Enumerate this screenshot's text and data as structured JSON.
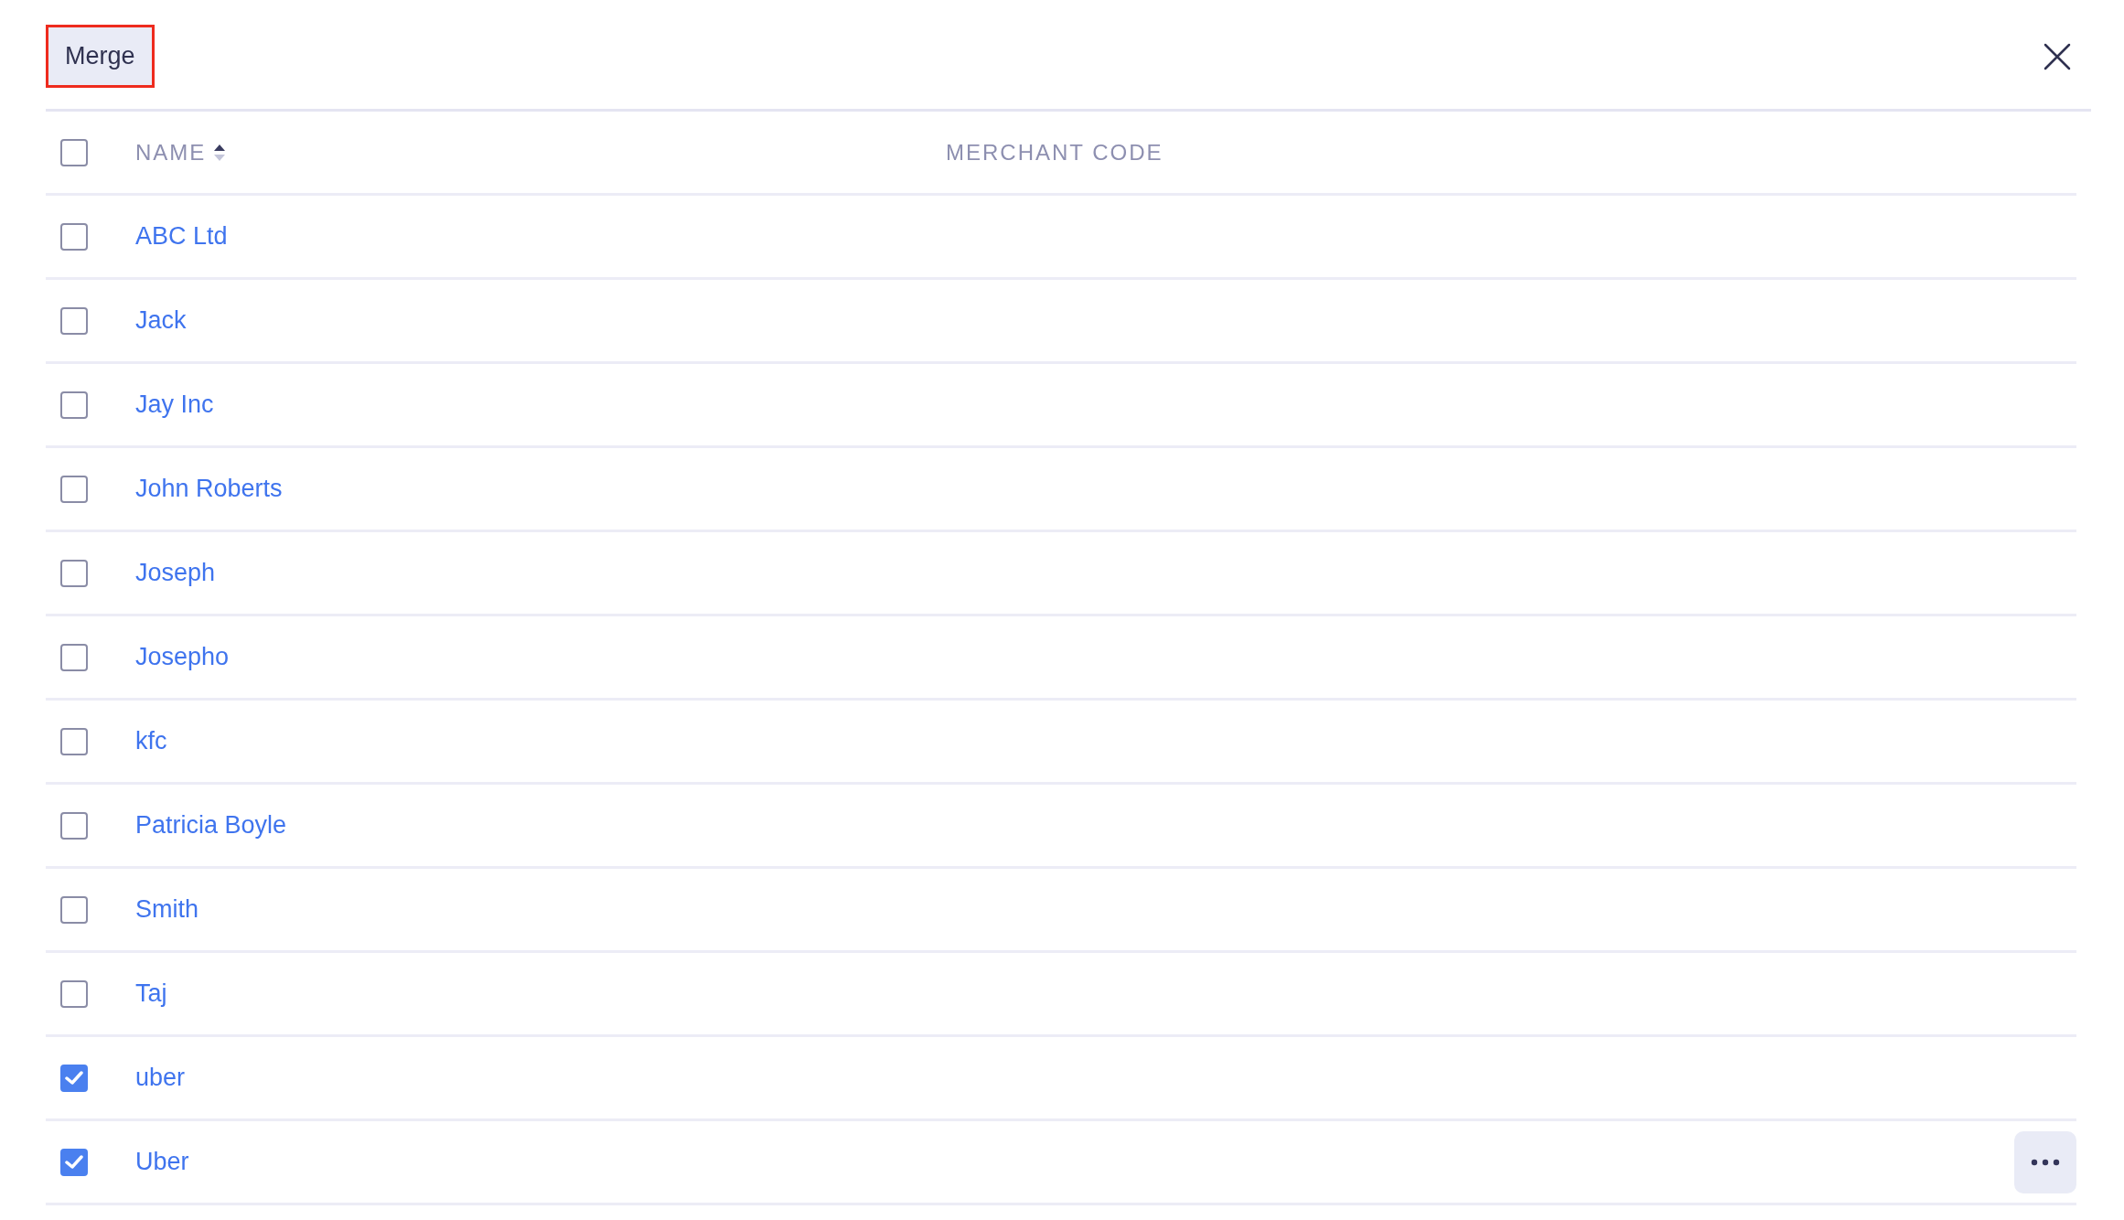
{
  "toolbar": {
    "merge_button": {
      "label": "Merge",
      "highlighted": true
    }
  },
  "table": {
    "select_all": {
      "checked": false
    },
    "columns": [
      {
        "label": "NAME",
        "sorted_ascending": true
      },
      {
        "label": "MERCHANT CODE"
      }
    ],
    "rows": [
      {
        "name": "ABC Ltd",
        "checked": false,
        "menu_button": false
      },
      {
        "name": "Jack",
        "checked": false,
        "menu_button": false
      },
      {
        "name": "Jay Inc",
        "checked": false,
        "menu_button": false
      },
      {
        "name": "John Roberts",
        "checked": false,
        "menu_button": false
      },
      {
        "name": "Joseph",
        "checked": false,
        "menu_button": false
      },
      {
        "name": "Josepho",
        "checked": false,
        "menu_button": false
      },
      {
        "name": "kfc",
        "checked": false,
        "menu_button": false
      },
      {
        "name": "Patricia Boyle",
        "checked": false,
        "menu_button": false
      },
      {
        "name": "Smith",
        "checked": false,
        "menu_button": false
      },
      {
        "name": "Taj",
        "checked": false,
        "menu_button": false
      },
      {
        "name": "uber",
        "checked": true,
        "menu_button": false
      },
      {
        "name": "Uber",
        "checked": true,
        "menu_button": true
      }
    ]
  }
}
